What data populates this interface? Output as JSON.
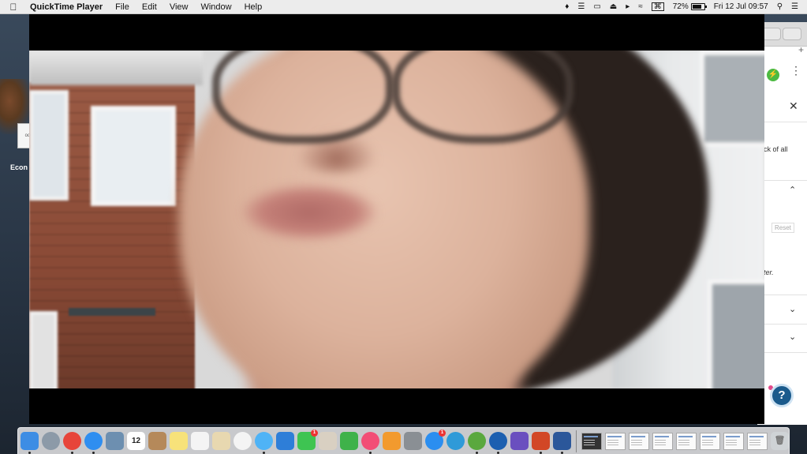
{
  "menubar": {
    "apple_icon": "apple-icon",
    "app_name": "QuickTime Player",
    "menus": [
      "File",
      "Edit",
      "View",
      "Window",
      "Help"
    ],
    "battery_percent": "72%",
    "datetime": "Fri 12 Jul  09:57",
    "input_badge": "⌘"
  },
  "desktop": {
    "file_label": "Econ",
    "file_icon_text": "od"
  },
  "background_window": {
    "side_text_1": "ck of all",
    "side_text_2": "ter.",
    "reset_label": "Reset",
    "new_tab_glyph": "+",
    "close_glyph": "✕",
    "chevron_up": "⌃",
    "chevron_down": "⌄",
    "help_glyph": "?",
    "extension_glyph": "⚡"
  },
  "dock": {
    "calendar_day": "12",
    "apps": [
      {
        "name": "Finder",
        "color": "#3d8de4"
      },
      {
        "name": "Launchpad",
        "color": "#8c9aa8"
      },
      {
        "name": "Chrome",
        "color": "#e7453a"
      },
      {
        "name": "Safari",
        "color": "#2f8ef0"
      },
      {
        "name": "Preview",
        "color": "#6d8fb0"
      },
      {
        "name": "Calendar",
        "color": "#ffffff"
      },
      {
        "name": "Contacts",
        "color": "#b5895a"
      },
      {
        "name": "Notes",
        "color": "#f7e27a"
      },
      {
        "name": "Reminders",
        "color": "#f4f4f4"
      },
      {
        "name": "Preview2",
        "color": "#e8d8b0"
      },
      {
        "name": "Photos",
        "color": "#f4f4f4"
      },
      {
        "name": "Messages",
        "color": "#4fb3f6"
      },
      {
        "name": "Keynote",
        "color": "#2e7ed8"
      },
      {
        "name": "FaceTime",
        "color": "#3ec452"
      },
      {
        "name": "Script",
        "color": "#d9d0c2"
      },
      {
        "name": "Numbers",
        "color": "#3fb24a"
      },
      {
        "name": "iTunes",
        "color": "#f24e76"
      },
      {
        "name": "iBooks",
        "color": "#f29a2e"
      },
      {
        "name": "SystemPreferences",
        "color": "#8a8f94"
      },
      {
        "name": "AppStore",
        "color": "#2b8ef0"
      },
      {
        "name": "Calculator",
        "color": "#2f9ad8"
      },
      {
        "name": "uTorrent",
        "color": "#5aa83e"
      },
      {
        "name": "QuickTime",
        "color": "#1c5fb0"
      },
      {
        "name": "iMovie",
        "color": "#6a4fbf"
      },
      {
        "name": "PowerPoint",
        "color": "#d24726"
      },
      {
        "name": "Word",
        "color": "#2b579a"
      }
    ],
    "thumb_count_label": "minimized windows"
  }
}
